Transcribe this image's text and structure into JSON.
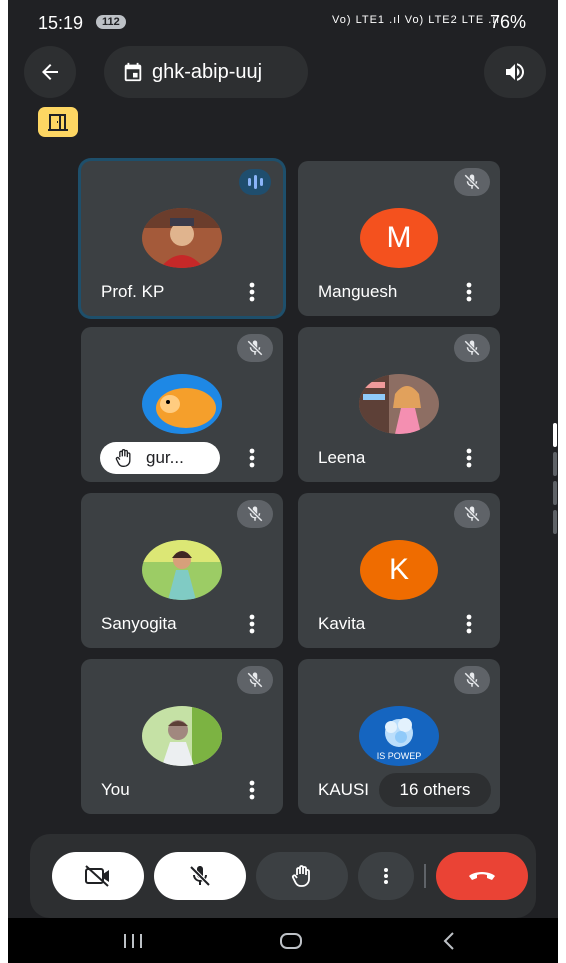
{
  "status": {
    "time": "15:19",
    "notification_count": "112",
    "network_icons": "Vo) LTE1 .ıl Vo) LTE2 LTE .ıl",
    "battery": "76%"
  },
  "header": {
    "meeting_code": "ghk-abip-uuj"
  },
  "participants": [
    {
      "name": "Prof. KP",
      "avatar": "photo"
    },
    {
      "name": "Manguesh",
      "initial": "M",
      "avatar_color": "#f4511e"
    },
    {
      "name": "gur...",
      "avatar": "photo"
    },
    {
      "name": "Leena",
      "avatar": "photo"
    },
    {
      "name": "Sanyogita",
      "avatar": "photo"
    },
    {
      "name": "Kavita",
      "initial": "K",
      "avatar_color": "#ef6c00"
    },
    {
      "name": "You",
      "avatar": "photo"
    },
    {
      "name": "KAUSI",
      "avatar": "photo",
      "overlay_text": "IS POWEP",
      "others_label": "16 others"
    }
  ],
  "colors": {
    "background": "#202124",
    "tile": "#3c4043",
    "end_call": "#ea4335",
    "room_badge": "#fdd663"
  },
  "icons": [
    "back-arrow-icon",
    "calendar-icon",
    "speaker-icon",
    "breakout-room-icon",
    "mic-off-icon",
    "speaking-icon",
    "more-vert-icon",
    "raise-hand-icon",
    "video-off-icon",
    "end-call-icon"
  ]
}
